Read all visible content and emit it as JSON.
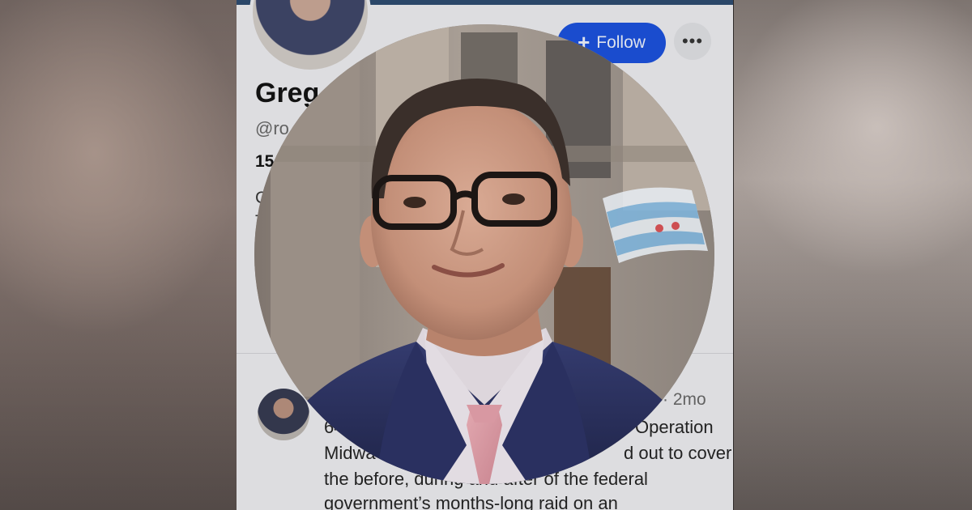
{
  "profile": {
    "follow_label": "Follow",
    "more_label": "•••",
    "name_visible": "Greg",
    "handle_visible": "@ro",
    "stat_visible": "15",
    "bio_visible": [
      "C",
      "T"
    ]
  },
  "post": {
    "time": "· 2mo",
    "lines": [
      "64",
      "Midwa",
      "the before, during and after of the federal",
      "government’s months-long raid on an"
    ],
    "line_right": [
      "Operation",
      "d out to cover"
    ]
  },
  "colors": {
    "follow_button": "#1a4fd9",
    "page_background": "#e9e9ec",
    "suit": "#2b3260",
    "tie": "#d79aa4"
  },
  "icons": {
    "follow": "plus-icon",
    "more": "more-dots-icon"
  }
}
